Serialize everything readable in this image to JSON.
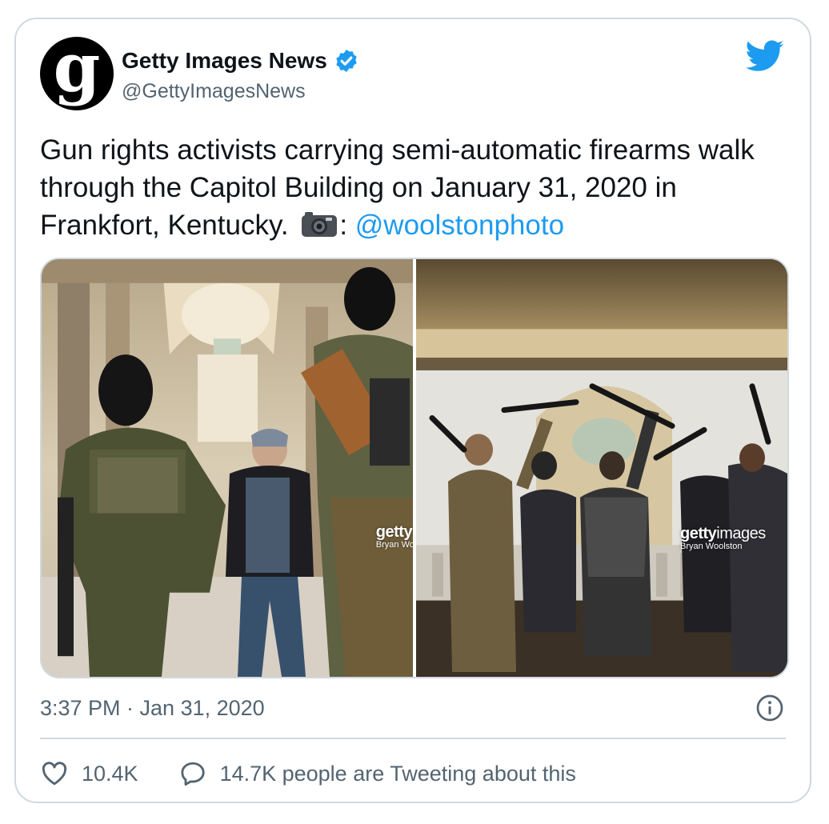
{
  "author": {
    "avatar_letter": "g",
    "display_name": "Getty Images News",
    "handle": "@GettyImagesNews",
    "verified": true
  },
  "tweet": {
    "text": "Gun rights activists carrying semi-automatic firearms walk through the Capitol Building on January 31, 2020 in Frankfort, Kentucky.",
    "camera_suffix": ":",
    "mention": "@woolstonphoto"
  },
  "media": {
    "left": {
      "watermark_brand": "getty",
      "watermark_credit": "Bryan Woo"
    },
    "right": {
      "watermark_brand": "getty",
      "watermark_brand_suffix": "images",
      "watermark_credit": "Bryan Woolston"
    }
  },
  "meta": {
    "timestamp": "3:37 PM · Jan 31, 2020"
  },
  "actions": {
    "likes": "10.4K",
    "conversation": "14.7K people are Tweeting about this"
  },
  "colors": {
    "accent": "#1d9bf0",
    "secondary_text": "#536471",
    "border": "#cfd9de"
  },
  "icons": [
    "verified-badge-icon",
    "twitter-bird-icon",
    "camera-icon",
    "info-icon",
    "heart-icon",
    "speech-bubble-icon"
  ]
}
